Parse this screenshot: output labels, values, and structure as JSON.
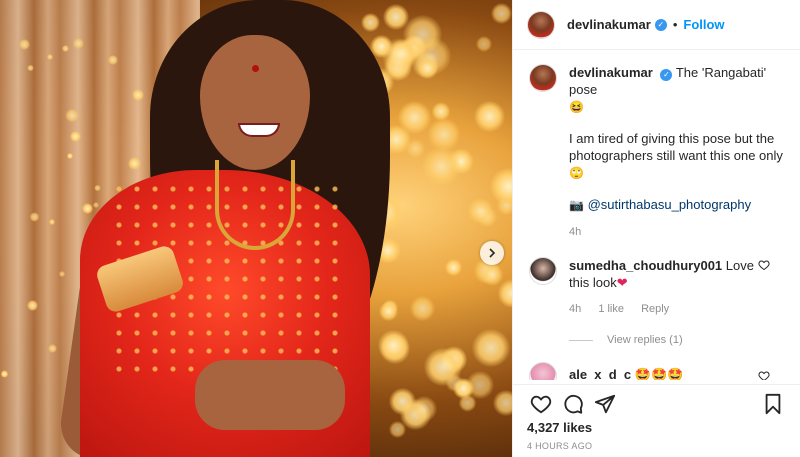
{
  "post": {
    "username": "devlinakumar",
    "follow_label": "Follow",
    "dot": "•",
    "caption": {
      "line1": "The 'Rangabati' pose",
      "emoji1": "😆",
      "line2": "I am tired of giving this pose but the photographers still want this one only",
      "emoji2": "🙄",
      "camera_emoji": "📷",
      "credit": "@sutirthabasu_photography",
      "time": "4h"
    },
    "likes": "4,327 likes",
    "timestamp": "4 HOURS AGO"
  },
  "comments": [
    {
      "username": "sumedha_choudhury001",
      "text": "Love this look",
      "emoji": "❤",
      "time": "4h",
      "likes": "1 like",
      "reply": "Reply",
      "view_replies": "View replies (1)"
    },
    {
      "username": "ale_x_d_c",
      "text": "🤩🤩🤩"
    }
  ],
  "icons": {
    "verified": "verified-badge",
    "next": "chevron-right-icon",
    "like": "heart-icon",
    "comment": "comment-icon",
    "share": "paper-plane-icon",
    "save": "bookmark-icon"
  },
  "colors": {
    "follow": "#0095f6",
    "verified": "#3897f0",
    "heart": "#ed4956"
  }
}
